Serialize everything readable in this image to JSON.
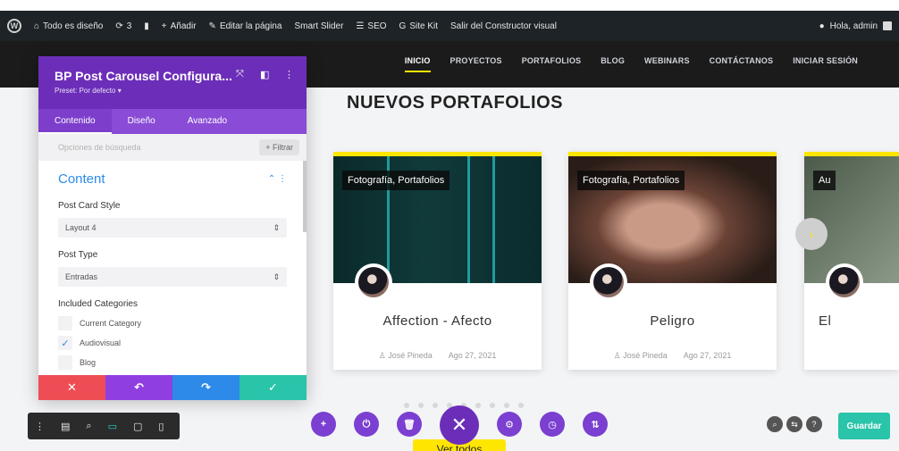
{
  "admin_bar": {
    "site_name": "Todo es diseño",
    "updates_count": "3",
    "new_label": "Añadir",
    "edit_label": "Editar la página",
    "smart_slider": "Smart Slider",
    "seo": "SEO",
    "site_kit": "Site Kit",
    "exit_builder": "Salir del Constructor visual",
    "greeting": "Hola, admin"
  },
  "nav": {
    "items": [
      "INICIO",
      "PROYECTOS",
      "PORTAFOLIOS",
      "BLOG",
      "WEBINARS",
      "CONTÁCTANOS",
      "INICIAR SESIÓN"
    ]
  },
  "section": {
    "title": "NUEVOS PORTAFOLIOS"
  },
  "cards": [
    {
      "tag": "Fotografía, Portafolios",
      "title": "Affection - Afecto",
      "author": "José Pineda",
      "date": "Ago 27, 2021"
    },
    {
      "tag": "Fotografía, Portafolios",
      "title": "Peligro",
      "author": "José Pineda",
      "date": "Ago 27, 2021"
    },
    {
      "tag": "Au",
      "title": "El",
      "author": "",
      "date": ""
    }
  ],
  "view_all": "Ver todos",
  "panel": {
    "title": "BP Post Carousel Configura...",
    "preset": "Preset: Por defecto ▾",
    "tabs": [
      "Contenido",
      "Diseño",
      "Avanzado"
    ],
    "search_placeholder": "Opciones de búsqueda",
    "filter": "+ Filtrar",
    "section_title": "Content",
    "post_card_style_label": "Post Card Style",
    "post_card_style_value": "Layout 4",
    "post_type_label": "Post Type",
    "post_type_value": "Entradas",
    "included_categories_label": "Included Categories",
    "categories": [
      {
        "label": "Current Category",
        "checked": false
      },
      {
        "label": "Audiovisual",
        "checked": true
      },
      {
        "label": "Blog",
        "checked": false
      }
    ]
  },
  "save_button": "Guardar",
  "colors": {
    "accent_purple": "#6c2eb9",
    "accent_yellow": "#ffe600",
    "save_green": "#29c4a9",
    "cancel_red": "#ef4d55",
    "undo_purple": "#8f3ee0",
    "redo_blue": "#2d8ae8",
    "confirm_green": "#29c4a9"
  }
}
